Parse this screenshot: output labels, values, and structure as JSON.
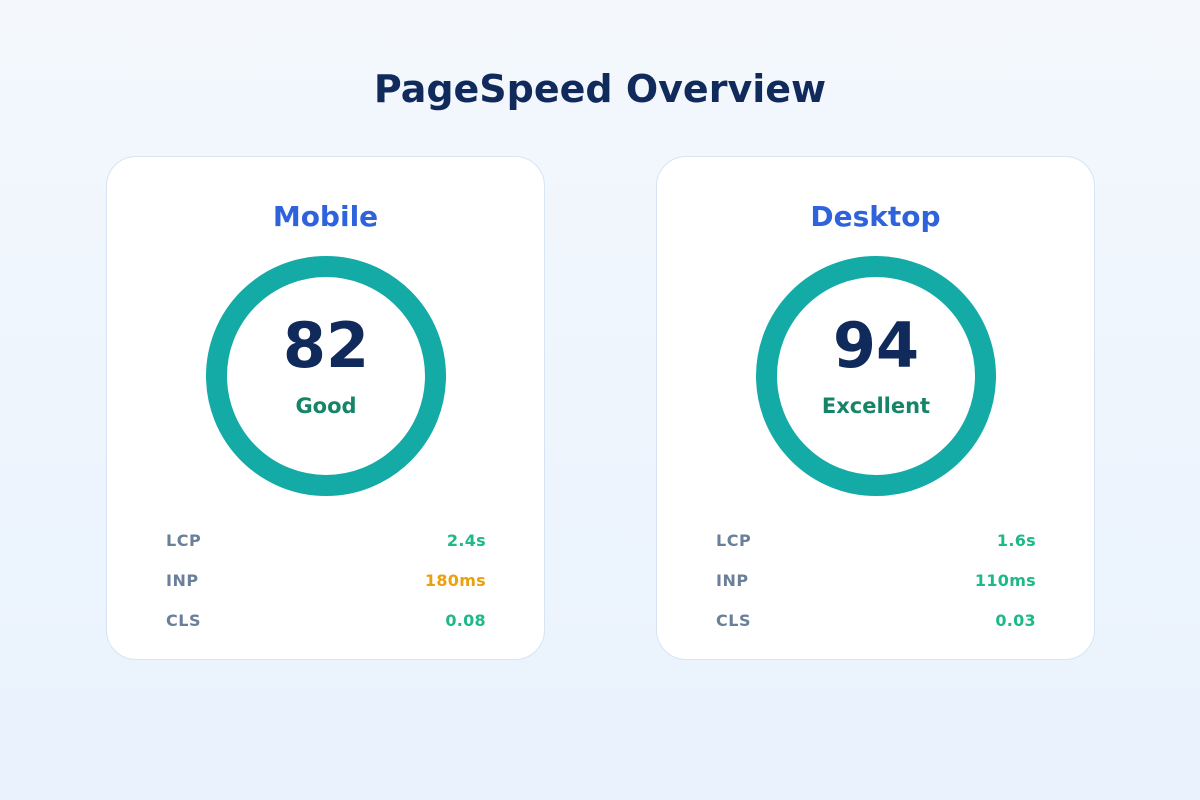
{
  "page": {
    "title": "PageSpeed Overview",
    "colors": {
      "title": "#102a5c",
      "card_title": "#2f63dc",
      "score": "#102a5c",
      "rating": "#168466",
      "ring": "#14aaa6",
      "good": "#1fb889",
      "needs_improvement": "#e9a10f",
      "metric_label": "#6a7f99"
    }
  },
  "cards": [
    {
      "title": "Mobile",
      "score": "82",
      "score_fraction": 0.82,
      "rating": "Good",
      "metrics": [
        {
          "label": "LCP",
          "value": "2.4s",
          "status": "good"
        },
        {
          "label": "INP",
          "value": "180ms",
          "status": "needs_improvement"
        },
        {
          "label": "CLS",
          "value": "0.08",
          "status": "good"
        }
      ]
    },
    {
      "title": "Desktop",
      "score": "94",
      "score_fraction": 0.94,
      "rating": "Excellent",
      "metrics": [
        {
          "label": "LCP",
          "value": "1.6s",
          "status": "good"
        },
        {
          "label": "INP",
          "value": "110ms",
          "status": "good"
        },
        {
          "label": "CLS",
          "value": "0.03",
          "status": "good"
        }
      ]
    }
  ]
}
